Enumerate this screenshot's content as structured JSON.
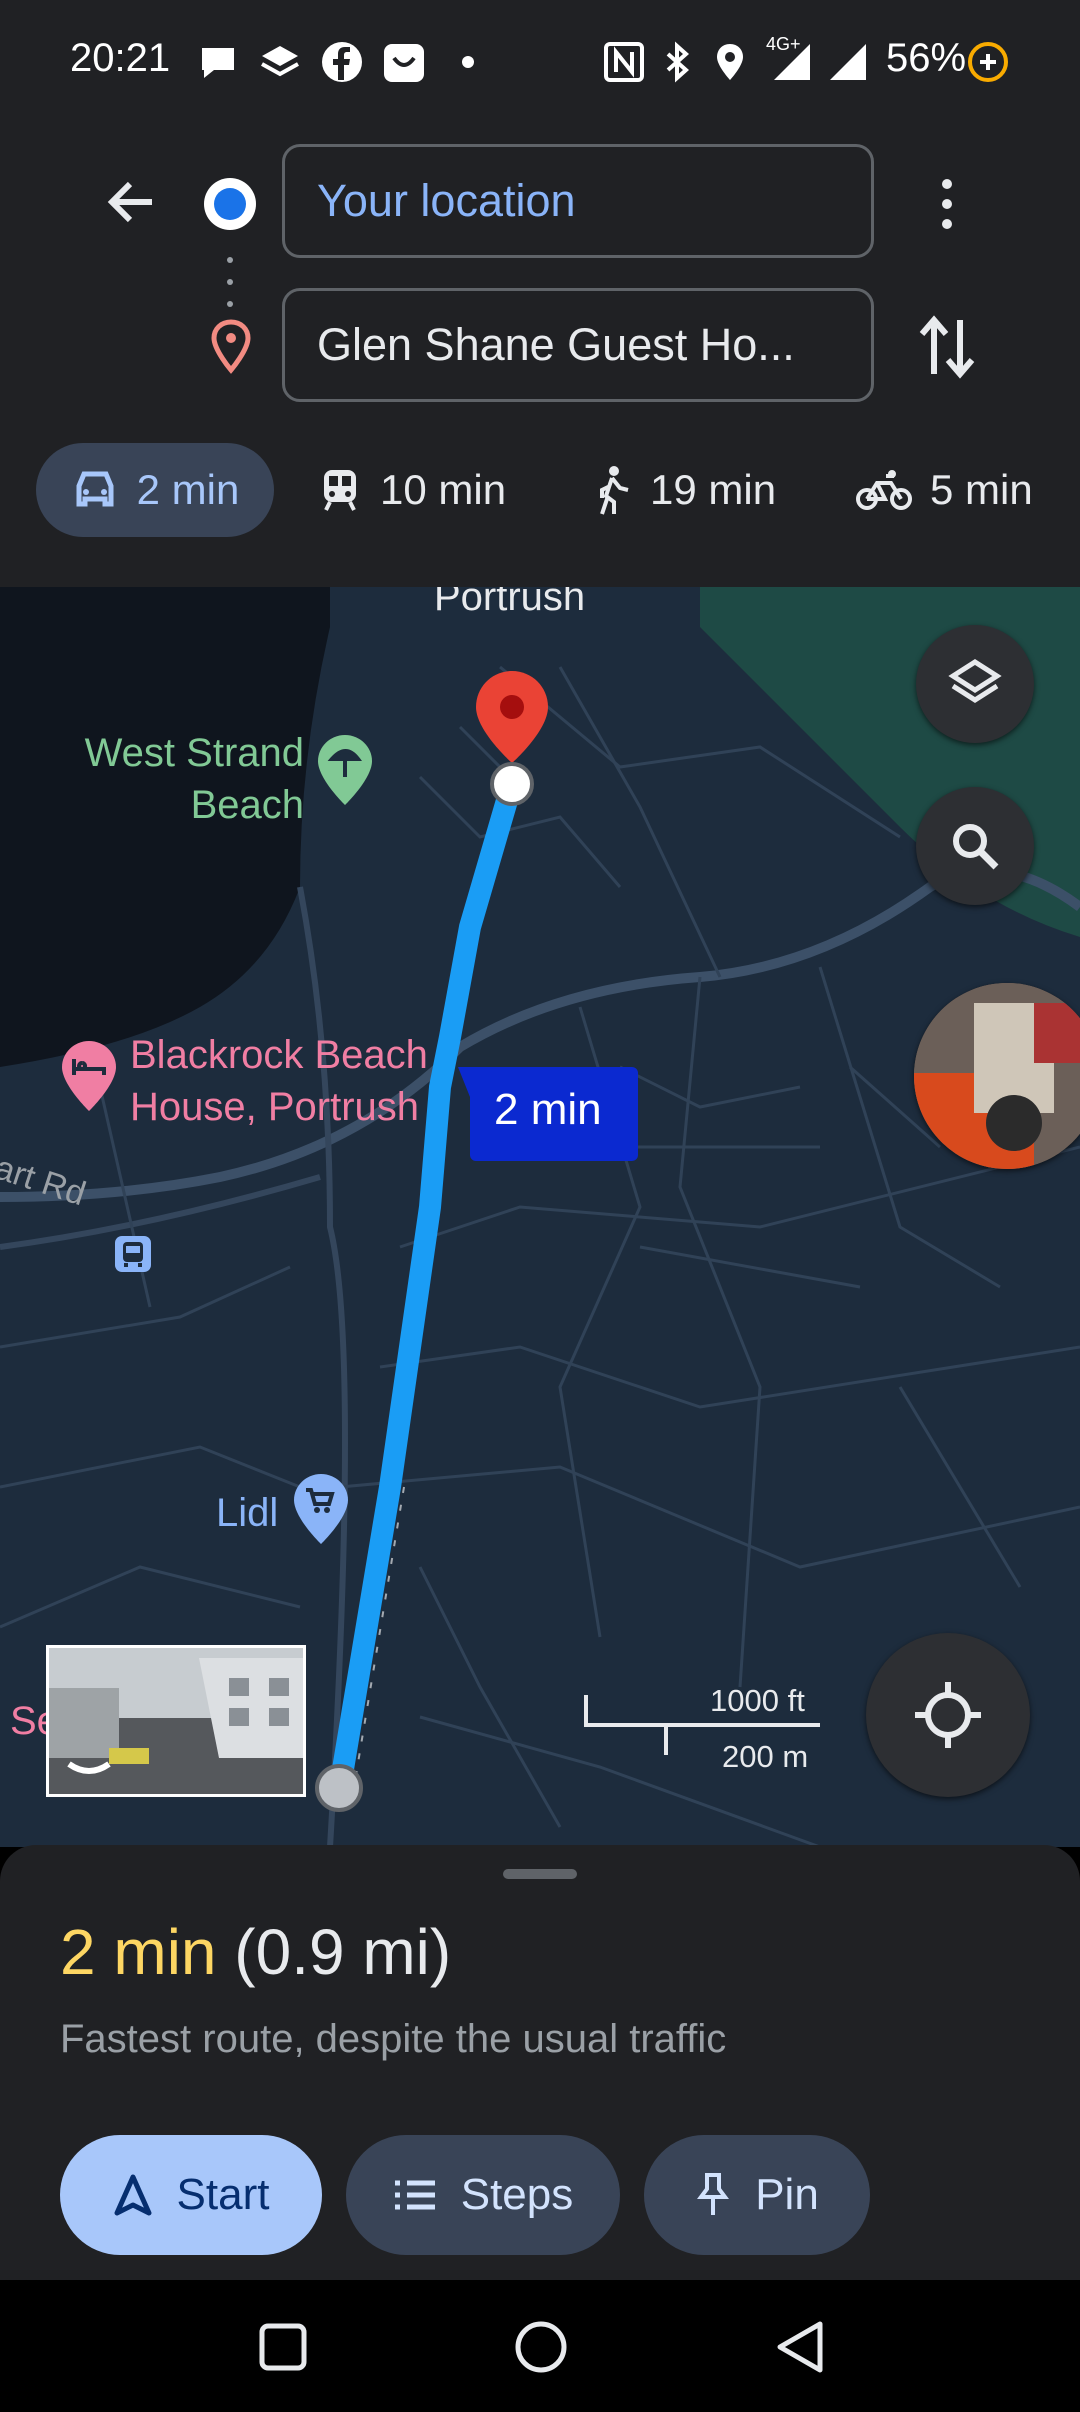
{
  "status_bar": {
    "time": "20:21",
    "battery": "56%",
    "network": "4G+",
    "icons": [
      "chat-icon",
      "layers-app-icon",
      "facebook-icon",
      "smile-app-icon",
      "dot-icon",
      "nfc-icon",
      "bluetooth-icon",
      "location-icon",
      "signal-icon",
      "signal-icon",
      "battery-saver-icon"
    ]
  },
  "header": {
    "origin_value": "Your location",
    "destination_value": "Glen Shane Guest Ho...",
    "modes": [
      {
        "name": "drive",
        "icon": "car-icon",
        "label": "2 min",
        "selected": true
      },
      {
        "name": "transit",
        "icon": "train-icon",
        "label": "10 min",
        "selected": false
      },
      {
        "name": "walk",
        "icon": "walk-icon",
        "label": "19 min",
        "selected": false
      },
      {
        "name": "bike",
        "icon": "bike-icon",
        "label": "5 min",
        "selected": false
      }
    ]
  },
  "map": {
    "labels": {
      "town": "Portrush",
      "beach": "West Strand\nBeach",
      "hotel": "Blackrock Beach\nHouse, Portrush",
      "road": "art Rd",
      "shop": "Lidl",
      "cut_label": "Se"
    },
    "route_time_badge": "2 min",
    "scale_imperial": "1000 ft",
    "scale_metric": "200 m",
    "colors": {
      "route": "#1a9df5",
      "badge": "#0b29d0",
      "pin": "#ea4335",
      "park": "#1e4a45"
    }
  },
  "sheet": {
    "duration": "2 min",
    "distance": "(0.9 mi)",
    "subtitle": "Fastest route, despite the usual traffic",
    "start_label": "Start",
    "steps_label": "Steps",
    "pin_label": "Pin"
  }
}
